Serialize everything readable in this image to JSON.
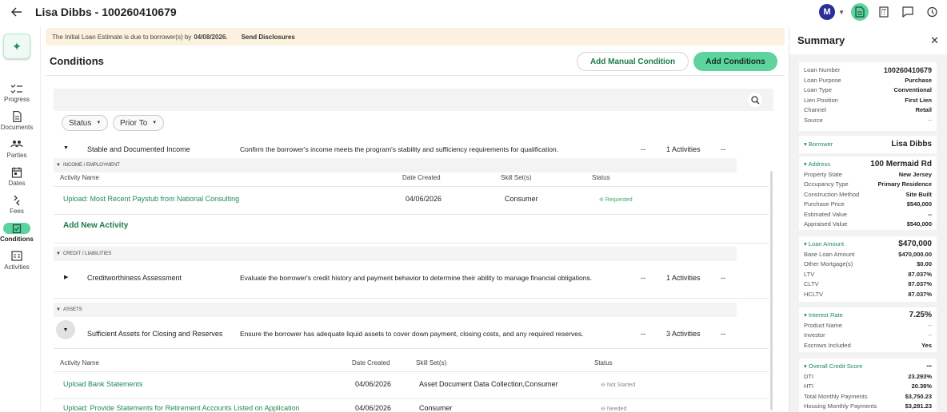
{
  "header": {
    "title": "Lisa Dibbs - 100260410679",
    "avatar_letter": "M"
  },
  "nav": {
    "items": [
      {
        "label": "Progress"
      },
      {
        "label": "Documents"
      },
      {
        "label": "Parties"
      },
      {
        "label": "Dates"
      },
      {
        "label": "Fees"
      },
      {
        "label": "Conditions"
      },
      {
        "label": "Activities"
      }
    ]
  },
  "banner": {
    "prefix": "The Initial Loan Estimate is due to borrower(s) by",
    "date": "04/08/2026.",
    "action": "Send Disclosures"
  },
  "conditions": {
    "title": "Conditions",
    "add_manual": "Add Manual Condition",
    "add_conditions": "Add Conditions",
    "filters": {
      "status": "Status",
      "prior_to": "Prior To"
    },
    "top_row": {
      "name": "Stable and Documented Income",
      "description": "Confirm the borrower's income meets the program's stability and sufficiency requirements for qualification.",
      "dash1": "--",
      "activities": "1 Activities",
      "dash2": "--"
    },
    "income_section": "INCOME / EMPLOYMENT",
    "income_activity_header": {
      "name": "Activity Name",
      "date": "Date Created",
      "skills": "Skill Set(s)",
      "status": "Status"
    },
    "income_activity": {
      "name": "Upload: Most Recent Paystub from National Consulting",
      "date": "04/06/2026",
      "skills": "Consumer",
      "status": "Requested"
    },
    "add_new_activity": "Add New Activity",
    "credit_section": "CREDIT / LIABILITIES",
    "credit_row": {
      "name": "Creditworthiness Assessment",
      "description": "Evaluate the borrower's credit history and payment behavior to determine their ability to manage financial obligations.",
      "dash1": "--",
      "activities": "1 Activities",
      "dash2": "--"
    },
    "assets_section": "ASSETS",
    "assets_row": {
      "name": "Sufficient Assets for Closing and Reserves",
      "description": "Ensure the borrower has adequate liquid assets to cover down payment, closing costs, and any required reserves.",
      "dash1": "--",
      "activities": "3 Activities",
      "dash2": "--"
    },
    "assets_activity_header": {
      "name": "Activity Name",
      "date": "Date Created",
      "skills": "Skill Set(s)",
      "status": "Status"
    },
    "assets_activities": [
      {
        "name": "Upload Bank Statements",
        "date": "04/06/2026",
        "skills": "Asset Document Data Collection,Consumer",
        "status": "Not Started"
      },
      {
        "name": "Upload: Provide Statements for Retirement Accounts Listed on Application",
        "date": "04/06/2026",
        "skills": "Consumer",
        "status": "Needed"
      }
    ]
  },
  "summary": {
    "title": "Summary",
    "loan": [
      {
        "k": "Loan Number",
        "v": "100260410679"
      },
      {
        "k": "Loan Purpose",
        "v": "Purchase"
      },
      {
        "k": "Loan Type",
        "v": "Conventional"
      },
      {
        "k": "Lien Position",
        "v": "First Lien"
      },
      {
        "k": "Channel",
        "v": "Retail"
      },
      {
        "k": "Source",
        "v": "--"
      }
    ],
    "borrower": {
      "k": "Borrower",
      "v": "Lisa Dibbs"
    },
    "address": {
      "k": "Address",
      "v": "100 Mermaid Rd"
    },
    "address_items": [
      {
        "k": "Property State",
        "v": "New Jersey"
      },
      {
        "k": "Occupancy Type",
        "v": "Primary Residence"
      },
      {
        "k": "Construction Method",
        "v": "Site Built"
      },
      {
        "k": "Purchase Price",
        "v": "$540,000"
      },
      {
        "k": "Estimated Value",
        "v": "--"
      },
      {
        "k": "Appraised Value",
        "v": "$540,000"
      }
    ],
    "loan_amount": {
      "k": "Loan Amount",
      "v": "$470,000"
    },
    "loan_amount_items": [
      {
        "k": "Base Loan Amount",
        "v": "$470,000.00"
      },
      {
        "k": "Other Mortgage(s)",
        "v": "$0.00"
      },
      {
        "k": "LTV",
        "v": "87.037%"
      },
      {
        "k": "CLTV",
        "v": "87.037%"
      },
      {
        "k": "HCLTV",
        "v": "87.037%"
      }
    ],
    "interest": {
      "k": "Interest Rate",
      "v": "7.25%"
    },
    "interest_items": [
      {
        "k": "Product Name",
        "v": "--"
      },
      {
        "k": "Investor",
        "v": "--"
      },
      {
        "k": "Escrows Included",
        "v": "Yes"
      }
    ],
    "credit": {
      "k": "Overall Credit Score",
      "v": "--"
    },
    "credit_items": [
      {
        "k": "DTI",
        "v": "23.293%"
      },
      {
        "k": "HTI",
        "v": "20.38%"
      },
      {
        "k": "Total Monthly Payments",
        "v": "$3,750.23"
      },
      {
        "k": "Housing Monthly Payments",
        "v": "$3,281.23"
      }
    ]
  }
}
